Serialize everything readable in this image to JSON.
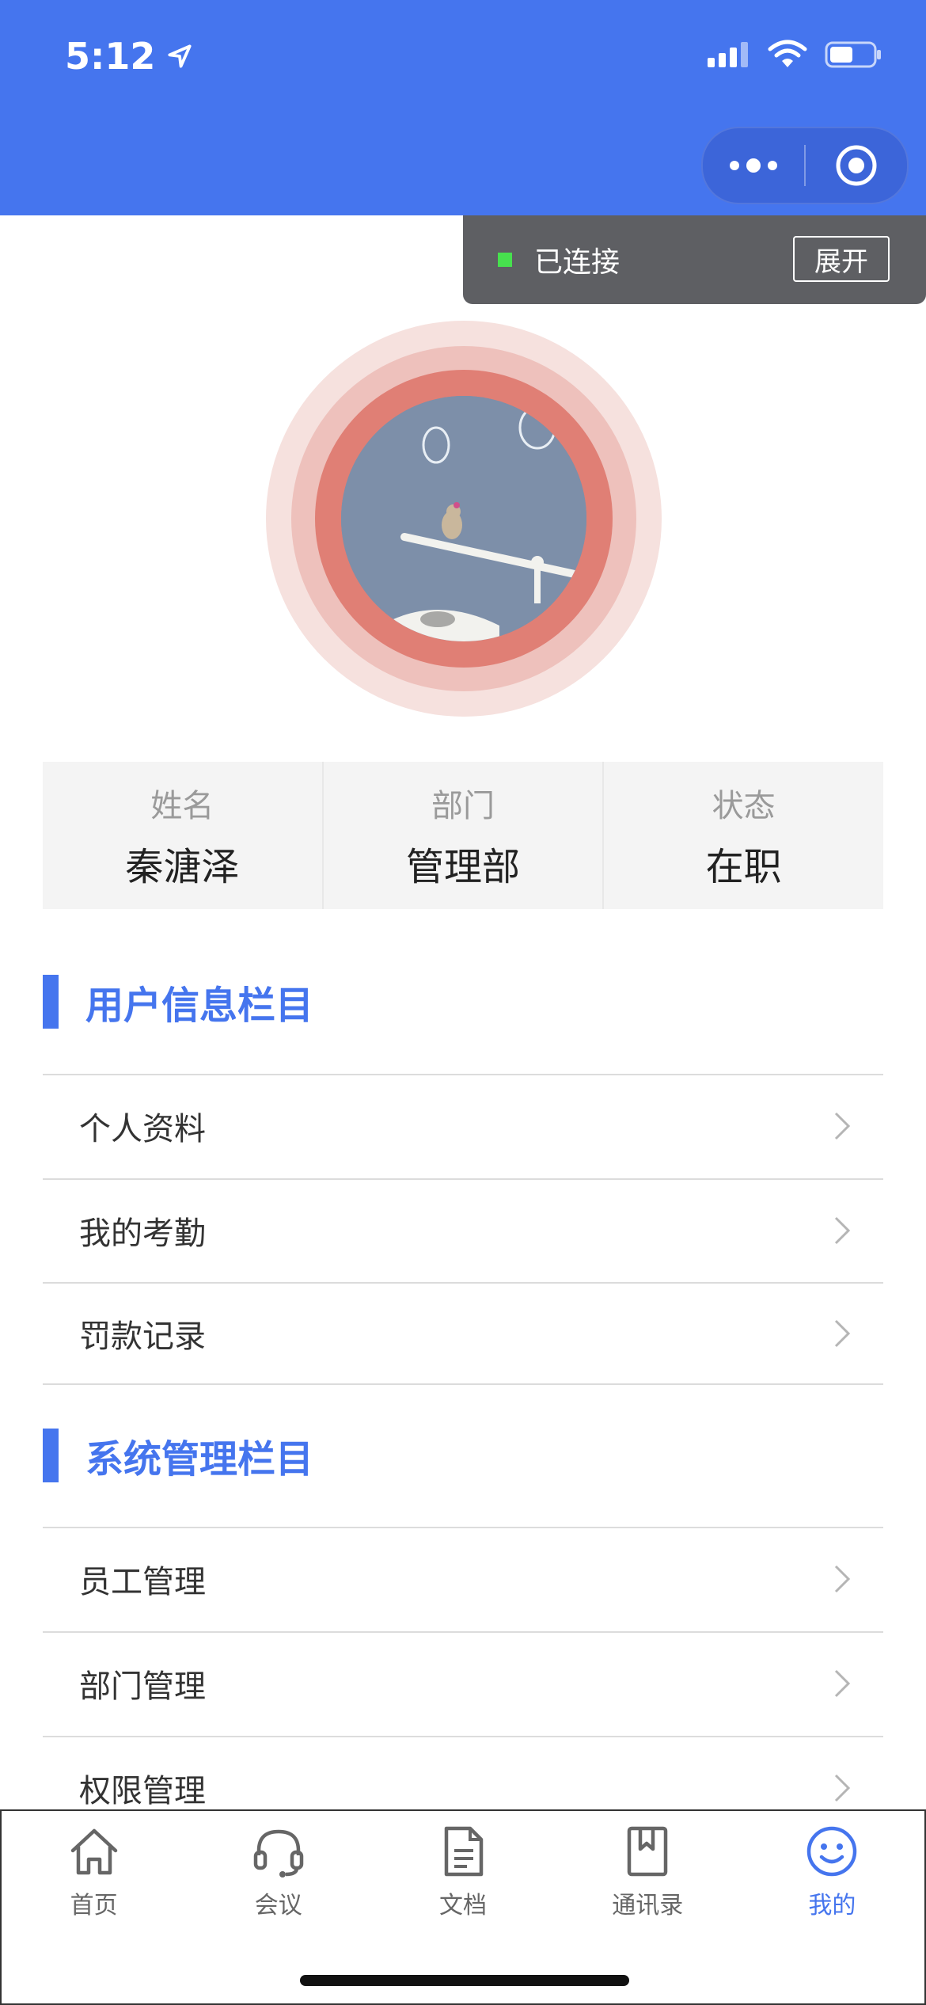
{
  "status_bar": {
    "time": "5:12"
  },
  "toast": {
    "status": "已连接",
    "button": "展开"
  },
  "profile": {
    "fields": [
      {
        "label": "姓名",
        "value": "秦溏泽"
      },
      {
        "label": "部门",
        "value": "管理部"
      },
      {
        "label": "状态",
        "value": "在职"
      }
    ]
  },
  "sections": [
    {
      "title": "用户信息栏目",
      "items": [
        "个人资料",
        "我的考勤",
        "罚款记录"
      ]
    },
    {
      "title": "系统管理栏目",
      "items": [
        "员工管理",
        "部门管理",
        "权限管理"
      ]
    }
  ],
  "tabbar": {
    "tabs": [
      {
        "label": "首页",
        "icon": "home-icon"
      },
      {
        "label": "会议",
        "icon": "headset-icon"
      },
      {
        "label": "文档",
        "icon": "document-icon"
      },
      {
        "label": "通讯录",
        "icon": "bookmark-book-icon"
      },
      {
        "label": "我的",
        "icon": "smile-icon"
      }
    ],
    "active_index": 4
  },
  "colors": {
    "primary": "#4575ee",
    "toast_bg": "#5e5f63",
    "connected": "#47e04e"
  }
}
